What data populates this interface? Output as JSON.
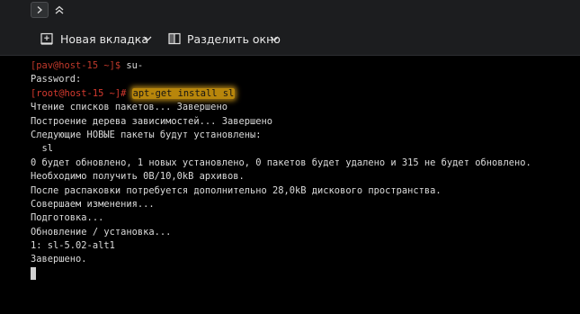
{
  "colors": {
    "background": "#000000",
    "toolbar": "#1c1d1f",
    "text": "#dcdcdc",
    "prompt": "#c0392b",
    "highlight": "#b8860b"
  },
  "titlebar": {
    "expand_icon": "chevron-right-icon",
    "collapse_icon": "chevrons-up-icon"
  },
  "toolbar": {
    "new_tab_label": "Новая вкладка",
    "new_tab_icon": "new-tab-icon",
    "split_label": "Разделить окно",
    "split_icon": "split-view-icon"
  },
  "terminal": {
    "line1": {
      "prompt": "[pav@host-15 ~]$",
      "command": " su-"
    },
    "line2": "Password:",
    "line3": {
      "prompt": "[root@host-15 ~]#",
      "command": "apt-get install sl"
    },
    "line4": "Чтение списков пакетов... Завершено",
    "line5": "Построение дерева зависимостей... Завершено",
    "line6": "Следующие НОВЫЕ пакеты будут установлены:",
    "line7": "  sl",
    "line8": "0 будет обновлено, 1 новых установлено, 0 пакетов будет удалено и 315 не будет обновлено.",
    "line9": "Необходимо получить 0B/10,0kB архивов.",
    "line10": "После распаковки потребуется дополнительно 28,0kB дискового пространства.",
    "line11": "Совершаем изменения...",
    "line12": "Подготовка...",
    "line13": "Обновление / установка...",
    "line14": "1: sl-5.02-alt1",
    "line15": "Завершено."
  }
}
